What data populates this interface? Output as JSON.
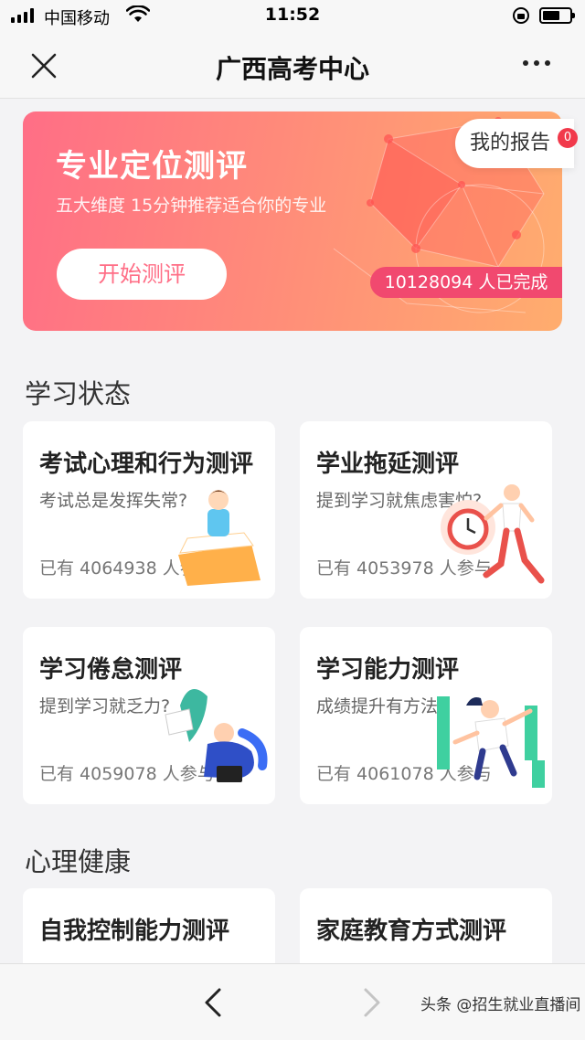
{
  "status_bar": {
    "carrier": "中国移动",
    "time": "11:52"
  },
  "nav": {
    "title": "广西高考中心"
  },
  "banner": {
    "title": "专业定位测评",
    "subtitle": "五大维度 15分钟推荐适合你的专业",
    "start_label": "开始测评",
    "completed_count": "10128094 人已完成",
    "report_label": "我的报告",
    "report_badge": "0"
  },
  "sections": [
    {
      "title": "学习状态",
      "cards": [
        {
          "title": "考试心理和行为测评",
          "subtitle": "考试总是发挥失常?",
          "count": "已有 4064938 人参与"
        },
        {
          "title": "学业拖延测评",
          "subtitle": "提到学习就焦虑害怕?",
          "count": "已有 4053978 人参与"
        },
        {
          "title": "学习倦怠测评",
          "subtitle": "提到学习就乏力?",
          "count": "已有 4059078 人参与"
        },
        {
          "title": "学习能力测评",
          "subtitle": "成绩提升有方法",
          "count": "已有 4061078 人参与"
        }
      ]
    },
    {
      "title": "心理健康",
      "cards": [
        {
          "title": "自我控制能力测评"
        },
        {
          "title": "家庭教育方式测评"
        }
      ]
    }
  ],
  "footer": {
    "watermark": "头条 @招生就业直播间"
  },
  "colors": {
    "banner_start": "#ff6e86",
    "banner_end": "#ffad6e",
    "badge_red": "#f1496f"
  }
}
